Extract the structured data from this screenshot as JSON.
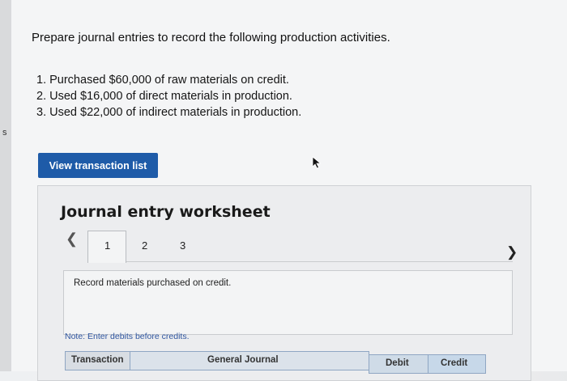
{
  "question": {
    "prompt": "Prepare journal entries to record the following production activities.",
    "steps": [
      "1. Purchased $60,000 of raw materials on credit.",
      "2. Used $16,000 of direct materials in production.",
      "3. Used $22,000 of indirect materials in production."
    ]
  },
  "edge_glyph": "s",
  "view_button_label": "View transaction list",
  "worksheet": {
    "title": "Journal entry worksheet",
    "tabs": [
      "1",
      "2",
      "3"
    ],
    "active_tab": "1",
    "instruction": "Record materials purchased on credit.",
    "note": "Note: Enter debits before credits.",
    "table_headers": [
      "Transaction",
      "General Journal",
      "Debit",
      "Credit"
    ]
  },
  "colors": {
    "accent": "#1e5ba8",
    "note": "#2f56a0"
  },
  "icons": {
    "prev": "chevron-left-icon",
    "next": "chevron-right-icon",
    "cursor": "mouse-pointer-icon"
  }
}
